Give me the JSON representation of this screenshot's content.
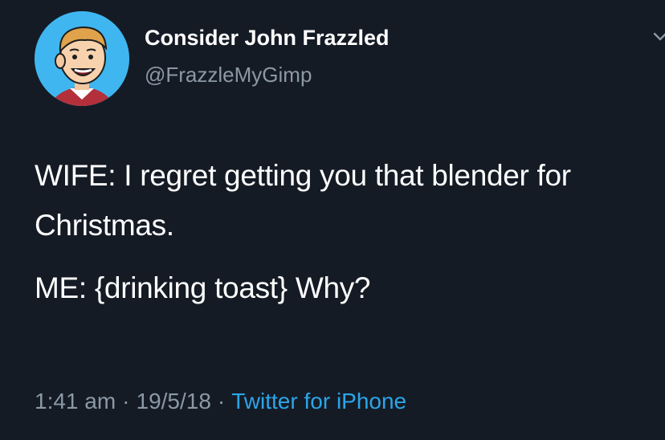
{
  "user": {
    "display_name": "Consider John Frazzled",
    "handle": "@FrazzleMyGimp"
  },
  "tweet": {
    "paragraphs": [
      "WIFE: I regret getting you that blender for Christmas.",
      "ME: {drinking toast} Why?"
    ],
    "time": "1:41 am",
    "date": "19/5/18",
    "separator": "·",
    "source": "Twitter for iPhone"
  },
  "colors": {
    "background": "#151b25",
    "primary_text": "#ffffff",
    "secondary_text": "#8b98a5",
    "link": "#2ca5e8",
    "avatar_bg": "#3fb6f0"
  },
  "icons": {
    "avatar": "cartoon-face-avatar",
    "menu": "chevron-down-icon"
  }
}
